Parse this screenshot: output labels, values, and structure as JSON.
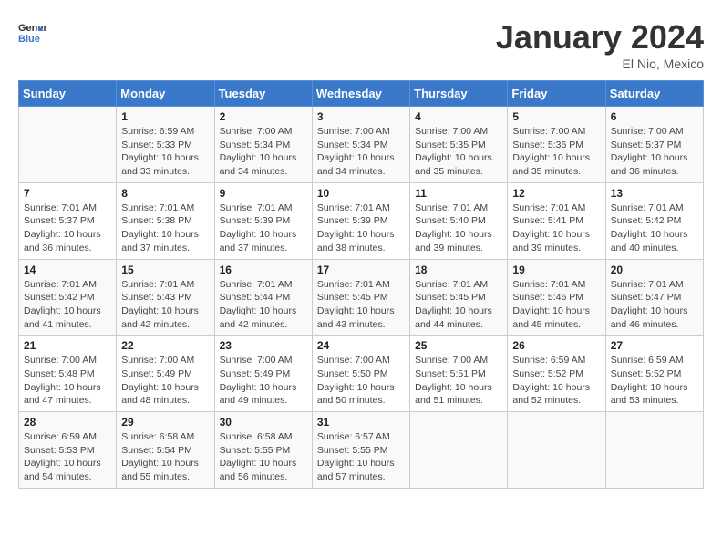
{
  "logo": {
    "line1": "General",
    "line2": "Blue"
  },
  "title": "January 2024",
  "subtitle": "El Nio, Mexico",
  "headers": [
    "Sunday",
    "Monday",
    "Tuesday",
    "Wednesday",
    "Thursday",
    "Friday",
    "Saturday"
  ],
  "weeks": [
    [
      {
        "day": "",
        "info": ""
      },
      {
        "day": "1",
        "info": "Sunrise: 6:59 AM\nSunset: 5:33 PM\nDaylight: 10 hours\nand 33 minutes."
      },
      {
        "day": "2",
        "info": "Sunrise: 7:00 AM\nSunset: 5:34 PM\nDaylight: 10 hours\nand 34 minutes."
      },
      {
        "day": "3",
        "info": "Sunrise: 7:00 AM\nSunset: 5:34 PM\nDaylight: 10 hours\nand 34 minutes."
      },
      {
        "day": "4",
        "info": "Sunrise: 7:00 AM\nSunset: 5:35 PM\nDaylight: 10 hours\nand 35 minutes."
      },
      {
        "day": "5",
        "info": "Sunrise: 7:00 AM\nSunset: 5:36 PM\nDaylight: 10 hours\nand 35 minutes."
      },
      {
        "day": "6",
        "info": "Sunrise: 7:00 AM\nSunset: 5:37 PM\nDaylight: 10 hours\nand 36 minutes."
      }
    ],
    [
      {
        "day": "7",
        "info": "Sunrise: 7:01 AM\nSunset: 5:37 PM\nDaylight: 10 hours\nand 36 minutes."
      },
      {
        "day": "8",
        "info": "Sunrise: 7:01 AM\nSunset: 5:38 PM\nDaylight: 10 hours\nand 37 minutes."
      },
      {
        "day": "9",
        "info": "Sunrise: 7:01 AM\nSunset: 5:39 PM\nDaylight: 10 hours\nand 37 minutes."
      },
      {
        "day": "10",
        "info": "Sunrise: 7:01 AM\nSunset: 5:39 PM\nDaylight: 10 hours\nand 38 minutes."
      },
      {
        "day": "11",
        "info": "Sunrise: 7:01 AM\nSunset: 5:40 PM\nDaylight: 10 hours\nand 39 minutes."
      },
      {
        "day": "12",
        "info": "Sunrise: 7:01 AM\nSunset: 5:41 PM\nDaylight: 10 hours\nand 39 minutes."
      },
      {
        "day": "13",
        "info": "Sunrise: 7:01 AM\nSunset: 5:42 PM\nDaylight: 10 hours\nand 40 minutes."
      }
    ],
    [
      {
        "day": "14",
        "info": "Sunrise: 7:01 AM\nSunset: 5:42 PM\nDaylight: 10 hours\nand 41 minutes."
      },
      {
        "day": "15",
        "info": "Sunrise: 7:01 AM\nSunset: 5:43 PM\nDaylight: 10 hours\nand 42 minutes."
      },
      {
        "day": "16",
        "info": "Sunrise: 7:01 AM\nSunset: 5:44 PM\nDaylight: 10 hours\nand 42 minutes."
      },
      {
        "day": "17",
        "info": "Sunrise: 7:01 AM\nSunset: 5:45 PM\nDaylight: 10 hours\nand 43 minutes."
      },
      {
        "day": "18",
        "info": "Sunrise: 7:01 AM\nSunset: 5:45 PM\nDaylight: 10 hours\nand 44 minutes."
      },
      {
        "day": "19",
        "info": "Sunrise: 7:01 AM\nSunset: 5:46 PM\nDaylight: 10 hours\nand 45 minutes."
      },
      {
        "day": "20",
        "info": "Sunrise: 7:01 AM\nSunset: 5:47 PM\nDaylight: 10 hours\nand 46 minutes."
      }
    ],
    [
      {
        "day": "21",
        "info": "Sunrise: 7:00 AM\nSunset: 5:48 PM\nDaylight: 10 hours\nand 47 minutes."
      },
      {
        "day": "22",
        "info": "Sunrise: 7:00 AM\nSunset: 5:49 PM\nDaylight: 10 hours\nand 48 minutes."
      },
      {
        "day": "23",
        "info": "Sunrise: 7:00 AM\nSunset: 5:49 PM\nDaylight: 10 hours\nand 49 minutes."
      },
      {
        "day": "24",
        "info": "Sunrise: 7:00 AM\nSunset: 5:50 PM\nDaylight: 10 hours\nand 50 minutes."
      },
      {
        "day": "25",
        "info": "Sunrise: 7:00 AM\nSunset: 5:51 PM\nDaylight: 10 hours\nand 51 minutes."
      },
      {
        "day": "26",
        "info": "Sunrise: 6:59 AM\nSunset: 5:52 PM\nDaylight: 10 hours\nand 52 minutes."
      },
      {
        "day": "27",
        "info": "Sunrise: 6:59 AM\nSunset: 5:52 PM\nDaylight: 10 hours\nand 53 minutes."
      }
    ],
    [
      {
        "day": "28",
        "info": "Sunrise: 6:59 AM\nSunset: 5:53 PM\nDaylight: 10 hours\nand 54 minutes."
      },
      {
        "day": "29",
        "info": "Sunrise: 6:58 AM\nSunset: 5:54 PM\nDaylight: 10 hours\nand 55 minutes."
      },
      {
        "day": "30",
        "info": "Sunrise: 6:58 AM\nSunset: 5:55 PM\nDaylight: 10 hours\nand 56 minutes."
      },
      {
        "day": "31",
        "info": "Sunrise: 6:57 AM\nSunset: 5:55 PM\nDaylight: 10 hours\nand 57 minutes."
      },
      {
        "day": "",
        "info": ""
      },
      {
        "day": "",
        "info": ""
      },
      {
        "day": "",
        "info": ""
      }
    ]
  ]
}
